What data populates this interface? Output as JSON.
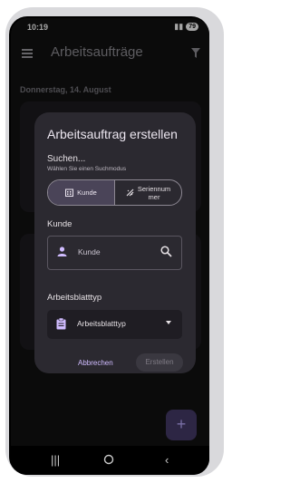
{
  "status_bar": {
    "time": "10:19",
    "battery": "79"
  },
  "app_bar": {
    "title": "Arbeitsaufträge"
  },
  "list": {
    "date_header": "Donnerstag, 14. August"
  },
  "dialog": {
    "title": "Arbeitsauftrag erstellen",
    "search_label": "Suchen...",
    "search_hint": "Wählen Sie einen Suchmodus",
    "modes": [
      {
        "label": "Kunde",
        "selected": true
      },
      {
        "label": "Seriennum\nmer",
        "selected": false
      }
    ],
    "customer_label": "Kunde",
    "customer_placeholder": "Kunde",
    "sheet_type_label": "Arbeitsblatttyp",
    "sheet_type_value": "Arbeitsblatttyp",
    "cancel_label": "Abbrechen",
    "create_label": "Erstellen"
  },
  "colors": {
    "accent": "#d0bcff",
    "surface": "#2b2930",
    "background": "#121212"
  },
  "icons": [
    "menu-icon",
    "filter-icon",
    "building-icon",
    "barcode-icon",
    "person-icon",
    "search-icon",
    "clipboard-icon",
    "dropdown-arrow-icon",
    "add-icon",
    "recents-icon",
    "home-icon",
    "back-icon"
  ]
}
